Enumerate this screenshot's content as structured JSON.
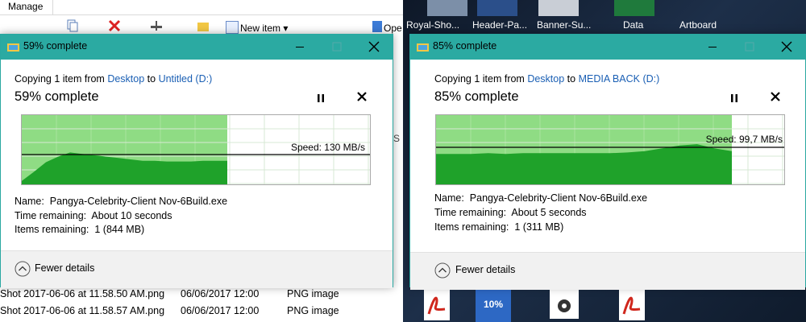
{
  "explorer": {
    "ribbon_tab": "Manage",
    "new_item": "New item",
    "open": "Ope",
    "side_letter": "S",
    "files": [
      {
        "name": "Shot 2017-06-06 at 11.58.50 AM.png",
        "date": "06/06/2017 12:00",
        "type": "PNG image"
      },
      {
        "name": "Shot 2017-06-06 at 11.58.57 AM.png",
        "date": "06/06/2017 12:00",
        "type": "PNG image"
      }
    ]
  },
  "desktop": {
    "labels": [
      "Royal-Sho...",
      "Header-Pa...",
      "Banner-Su...",
      "Data",
      "Artboard"
    ],
    "thumb_badge": "10%"
  },
  "dialogs": [
    {
      "title": "59% complete",
      "copy_prefix": "Copying 1 item from ",
      "source": "Desktop",
      "to": " to ",
      "destination": "Untitled (D:)",
      "percent_text": "59% complete",
      "progress": 0.59,
      "speed": "Speed: 130 MB/s",
      "name_label": "Name:",
      "name_value": "Pangya-Celebrity-Client Nov-6Build.exe",
      "time_label": "Time remaining:",
      "time_value": "About 10 seconds",
      "items_label": "Items remaining:",
      "items_value": "1 (844 MB)",
      "fewer_details": "Fewer details"
    },
    {
      "title": "85% complete",
      "copy_prefix": "Copying 1 item from ",
      "source": "Desktop",
      "to": " to ",
      "destination": "MEDIA BACK (D:)",
      "percent_text": "85% complete",
      "progress": 0.85,
      "speed": "Speed: 99,7 MB/s",
      "name_label": "Name:",
      "name_value": "Pangya-Celebrity-Client Nov-6Build.exe",
      "time_label": "Time remaining:",
      "time_value": "About 5 seconds",
      "items_label": "Items remaining:",
      "items_value": "1 (311 MB)",
      "fewer_details": "Fewer details"
    }
  ],
  "colors": {
    "titlebar": "#2baaa2",
    "graph_fill_light": "#8fdc84",
    "graph_fill_dark": "#1fa22a",
    "link": "#1a5fb4"
  }
}
